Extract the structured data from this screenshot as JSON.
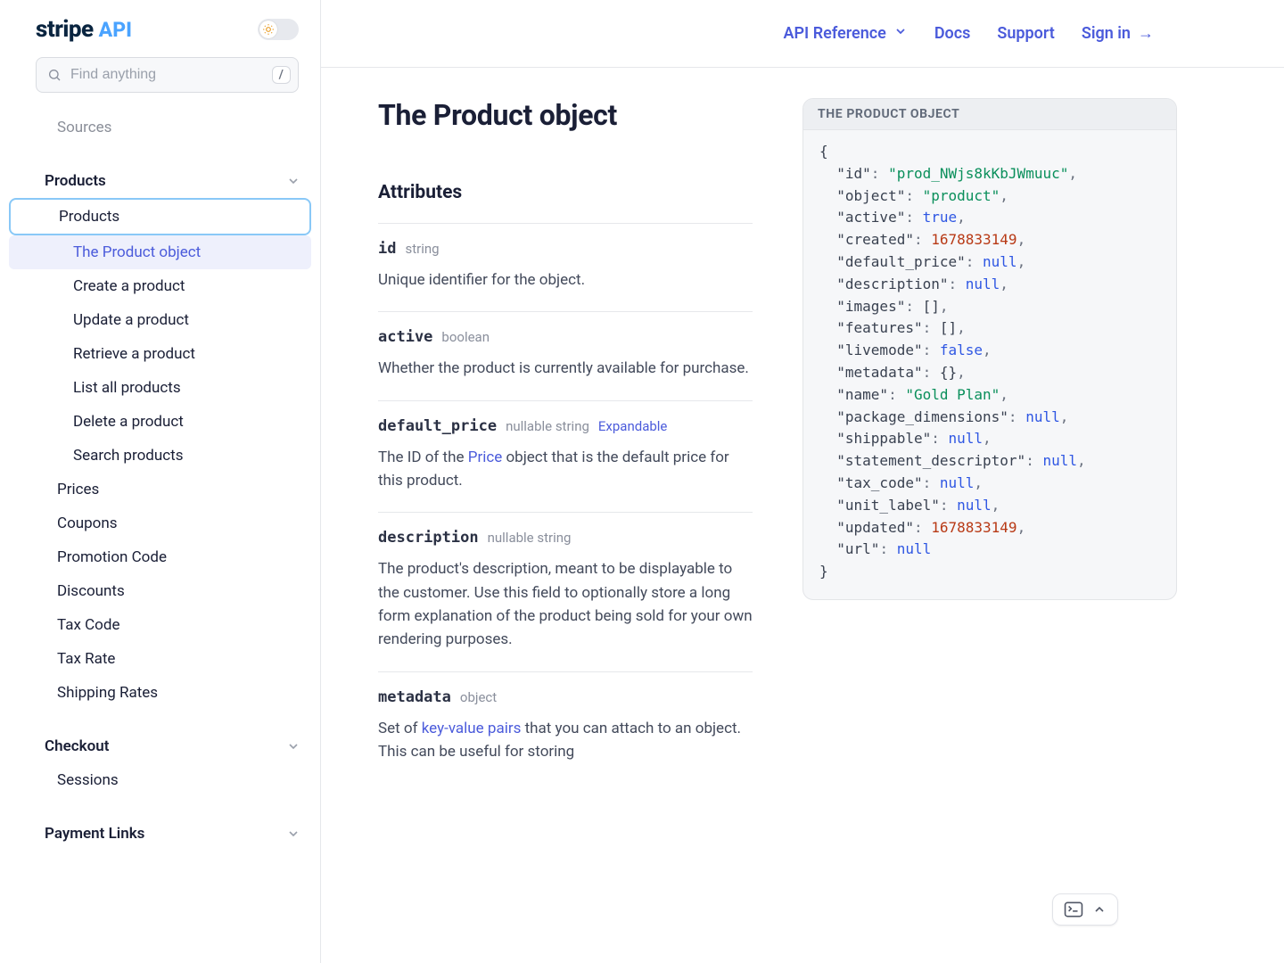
{
  "brand": {
    "name": "stripe",
    "suffix": "API"
  },
  "search": {
    "placeholder": "Find anything",
    "shortcut": "/"
  },
  "topbar": {
    "api_reference": "API Reference",
    "docs": "Docs",
    "support": "Support",
    "sign_in": "Sign in"
  },
  "sidebar": {
    "sources": "Sources",
    "products_section": "Products",
    "products": {
      "label": "Products",
      "children": [
        "The Product object",
        "Create a product",
        "Update a product",
        "Retrieve a product",
        "List all products",
        "Delete a product",
        "Search products"
      ]
    },
    "prices": "Prices",
    "coupons": "Coupons",
    "promotion_code": "Promotion Code",
    "discounts": "Discounts",
    "tax_code": "Tax Code",
    "tax_rate": "Tax Rate",
    "shipping_rates": "Shipping Rates",
    "checkout_section": "Checkout",
    "sessions": "Sessions",
    "payment_links_section": "Payment Links"
  },
  "page": {
    "title": "The Product object",
    "attributes_heading": "Attributes"
  },
  "attributes": [
    {
      "name": "id",
      "type": "string",
      "desc_plain": "Unique identifier for the object."
    },
    {
      "name": "active",
      "type": "boolean",
      "desc_plain": "Whether the product is currently available for purchase."
    },
    {
      "name": "default_price",
      "type": "nullable string",
      "expandable": "Expandable",
      "desc_pre": "The ID of the ",
      "desc_link": "Price",
      "desc_post": " object that is the default price for this product."
    },
    {
      "name": "description",
      "type": "nullable string",
      "desc_plain": "The product's description, meant to be displayable to the customer. Use this field to optionally store a long form explanation of the product being sold for your own rendering purposes."
    },
    {
      "name": "metadata",
      "type": "object",
      "desc_pre": "Set of ",
      "desc_link": "key-value pairs",
      "desc_post": " that you can attach to an object. This can be useful for storing"
    }
  ],
  "code": {
    "title": "THE PRODUCT OBJECT",
    "object": {
      "id": "prod_NWjs8kKbJWmuuc",
      "object": "product",
      "active": true,
      "created": 1678833149,
      "default_price": null,
      "description": null,
      "images": "[]",
      "features": "[]",
      "livemode": false,
      "metadata": "{}",
      "name": "Gold Plan",
      "package_dimensions": null,
      "shippable": null,
      "statement_descriptor": null,
      "tax_code": null,
      "unit_label": null,
      "updated": 1678833149,
      "url": null
    }
  }
}
